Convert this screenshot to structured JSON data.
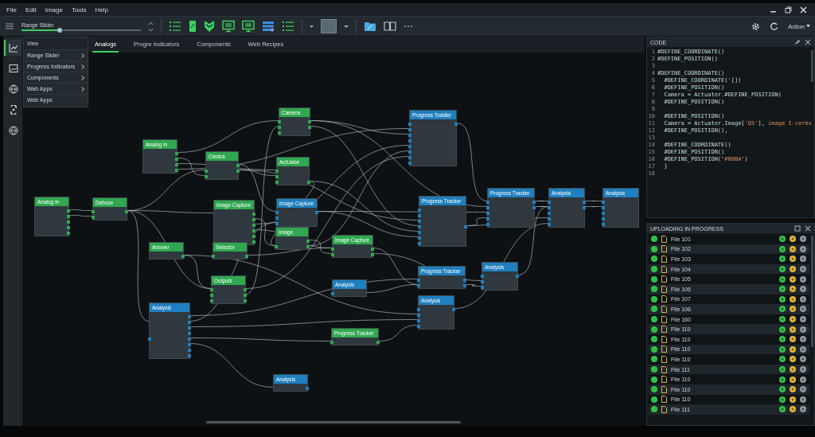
{
  "menu": [
    "File",
    "Edit",
    "Image",
    "Tools",
    "Help"
  ],
  "toolbar": {
    "slider": {
      "label": "Range Slider",
      "level": 0.32
    },
    "account": "Action"
  },
  "sidebar": {
    "items": [
      {
        "selected": true
      },
      {
        "selected": false
      },
      {
        "selected": false
      },
      {
        "selected": false
      },
      {
        "selected": false
      }
    ]
  },
  "dropdown": {
    "header": "View",
    "items": [
      {
        "label": "Range Slider",
        "submenu": true
      },
      {
        "label": "Progress Indicators",
        "submenu": true
      },
      {
        "label": "Components",
        "submenu": true
      },
      {
        "label": "Web Apps",
        "submenu": true
      },
      {
        "label": "Web Apps",
        "submenu": false
      }
    ]
  },
  "tabs": [
    {
      "label": "Analogs",
      "selected": true
    },
    {
      "label": "Progre Indicators",
      "selected": false
    },
    {
      "label": "Components",
      "selected": false
    },
    {
      "label": "Web Recipes",
      "selected": false
    }
  ],
  "nodes": [
    {
      "title": "Analog In",
      "color": "#2fa84f",
      "rows": [
        {
          "in": false,
          "out": true
        },
        {
          "in": false,
          "out": true
        },
        {
          "in": false,
          "out": true
        },
        {
          "in": false,
          "out": true
        },
        {
          "in": false,
          "out": true
        }
      ]
    },
    {
      "title": "Deboce",
      "color": "#2fa84f",
      "rows": [
        {
          "in": true,
          "out": true
        },
        {
          "in": true,
          "out": false
        }
      ]
    },
    {
      "title": "Analog In",
      "color": "#2fa84f",
      "rows": [
        {
          "in": false,
          "out": true
        },
        {
          "in": false,
          "out": true
        },
        {
          "in": false,
          "out": true
        },
        {
          "in": false,
          "out": true
        }
      ]
    },
    {
      "title": "Clestra",
      "color": "#2fa84f",
      "rows": [
        {
          "in": false,
          "out": true
        },
        {
          "in": true,
          "out": true
        },
        {
          "in": true,
          "out": false
        }
      ]
    },
    {
      "title": "Camera",
      "color": "#2fa84f",
      "rows": [
        {
          "in": true,
          "out": true
        },
        {
          "in": true,
          "out": true
        },
        {
          "in": true,
          "out": false
        }
      ]
    },
    {
      "title": "ActUator",
      "color": "#2fa84f",
      "rows": [
        {
          "in": true,
          "out": false
        },
        {
          "in": true,
          "out": false
        },
        {
          "in": true,
          "out": true
        }
      ]
    },
    {
      "title": "Image Capture",
      "color": "#2fa84f",
      "rows": [
        {
          "in": false,
          "out": true
        },
        {
          "in": false,
          "out": true
        },
        {
          "in": false,
          "out": true
        },
        {
          "in": false,
          "out": true
        },
        {
          "in": false,
          "out": true
        },
        {
          "in": false,
          "out": true
        }
      ]
    },
    {
      "title": "Image Capture",
      "color": "#1f7fbf",
      "rows": [
        {
          "in": true,
          "out": true
        },
        {
          "in": true,
          "out": false
        },
        {
          "in": true,
          "out": false
        }
      ]
    },
    {
      "title": "Image",
      "color": "#2fa84f",
      "rows": [
        {
          "in": false,
          "out": true
        },
        {
          "in": true,
          "out": true
        }
      ]
    },
    {
      "title": "Answer",
      "color": "#2fa84f",
      "rows": [
        {
          "in": false,
          "out": true
        }
      ]
    },
    {
      "title": "Selector",
      "color": "#2fa84f",
      "rows": [
        {
          "in": true,
          "out": true
        }
      ]
    },
    {
      "title": "Outputs",
      "color": "#2fa84f",
      "rows": [
        {
          "in": true,
          "out": true
        },
        {
          "in": true,
          "out": true
        },
        {
          "in": true,
          "out": true
        }
      ]
    },
    {
      "title": "Analysis",
      "color": "#1f7fbf",
      "rows": [
        {
          "in": false,
          "out": true
        },
        {
          "in": false,
          "out": true
        },
        {
          "in": false,
          "out": true
        },
        {
          "in": false,
          "out": true
        },
        {
          "in": true,
          "out": true
        },
        {
          "in": false,
          "out": true
        },
        {
          "in": false,
          "out": true
        },
        {
          "in": false,
          "out": true
        }
      ]
    },
    {
      "title": "Progress Toddler",
      "color": "#1f7fbf",
      "rows": [
        {
          "in": true,
          "out": true
        },
        {
          "in": true,
          "out": false
        },
        {
          "in": true,
          "out": false
        },
        {
          "in": true,
          "out": false
        },
        {
          "in": true,
          "out": false
        },
        {
          "in": true,
          "out": false
        },
        {
          "in": true,
          "out": false
        },
        {
          "in": true,
          "out": false
        }
      ]
    },
    {
      "title": "Progress Tracker",
      "color": "#1f7fbf",
      "rows": [
        {
          "in": true,
          "out": false
        },
        {
          "in": true,
          "out": false
        },
        {
          "in": true,
          "out": false
        },
        {
          "in": true,
          "out": true
        },
        {
          "in": true,
          "out": false
        },
        {
          "in": true,
          "out": false
        },
        {
          "in": true,
          "out": false
        }
      ]
    },
    {
      "title": "Image Capture",
      "color": "#2fa84f",
      "rows": [
        {
          "in": true,
          "out": true
        },
        {
          "in": true,
          "out": true
        }
      ]
    },
    {
      "title": "Analysis",
      "color": "#1f7fbf",
      "rows": [
        {
          "in": true,
          "out": false
        }
      ]
    },
    {
      "title": "Progress Tracker",
      "color": "#2fa84f",
      "rows": [
        {
          "in": true,
          "out": true
        }
      ]
    },
    {
      "title": "Progress Tracker",
      "color": "#1f7fbf",
      "rows": [
        {
          "in": true,
          "out": true
        },
        {
          "in": true,
          "out": true
        }
      ]
    },
    {
      "title": "Analysis",
      "color": "#1f7fbf",
      "rows": [
        {
          "in": true,
          "out": true
        },
        {
          "in": true,
          "out": false
        },
        {
          "in": true,
          "out": false
        },
        {
          "in": true,
          "out": false
        }
      ]
    },
    {
      "title": "Analysis",
      "color": "#1f7fbf",
      "rows": [
        {
          "in": true,
          "out": true
        },
        {
          "in": true,
          "out": false
        },
        {
          "in": true,
          "out": false
        }
      ]
    },
    {
      "title": "Progress Tracker",
      "color": "#1f7fbf",
      "rows": [
        {
          "in": true,
          "out": true
        },
        {
          "in": true,
          "out": true
        },
        {
          "in": true,
          "out": false
        },
        {
          "in": true,
          "out": false
        },
        {
          "in": true,
          "out": false
        }
      ]
    },
    {
      "title": "Analysis",
      "color": "#1f7fbf",
      "rows": [
        {
          "in": true,
          "out": true
        },
        {
          "in": true,
          "out": true
        },
        {
          "in": true,
          "out": false
        },
        {
          "in": true,
          "out": false
        },
        {
          "in": true,
          "out": false
        }
      ]
    },
    {
      "title": "Analysis",
      "color": "#1f7fbf",
      "rows": [
        {
          "in": true,
          "out": false
        },
        {
          "in": true,
          "out": false
        },
        {
          "in": true,
          "out": false
        },
        {
          "in": true,
          "out": false
        },
        {
          "in": true,
          "out": false
        }
      ]
    },
    {
      "title": "Analysis",
      "color": "#1f7fbf",
      "rows": [
        {
          "in": false,
          "out": true
        }
      ]
    }
  ],
  "code": {
    "title": "CODE",
    "lines": [
      {
        "n": "1",
        "parts": [
          {
            "kind": "plain",
            "t": "#DEFINE_COORDINATE()"
          }
        ]
      },
      {
        "n": "2",
        "parts": [
          {
            "kind": "plain",
            "t": "#DEFINE_POSITION()"
          }
        ]
      },
      {
        "n": "3"
      },
      {
        "n": "4",
        "parts": [
          {
            "kind": "plain",
            "t": "#DEFINE_COORDINATE()"
          }
        ]
      },
      {
        "n": "5",
        "parts": [
          {
            "kind": "plain",
            "t": "  #DEFINE_COORDINATE('[])"
          }
        ]
      },
      {
        "n": "6",
        "parts": [
          {
            "kind": "plain",
            "t": "  #DEFINE_POSITION()"
          }
        ]
      },
      {
        "n": "7",
        "parts": [
          {
            "kind": "plain",
            "t": "  Camera = Actuator.#DEFINE_POSITION)"
          }
        ]
      },
      {
        "n": "8",
        "parts": [
          {
            "kind": "plain",
            "t": "  #DEFINE_POSITION()"
          }
        ]
      },
      {
        "n": "9"
      },
      {
        "n": "10",
        "parts": [
          {
            "kind": "plain",
            "t": "  #DEFINE_POSITION()"
          }
        ]
      },
      {
        "n": "11",
        "parts": [
          {
            "kind": "plain",
            "t": "  Camera = Actuator.Image["
          },
          {
            "kind": "string",
            "t": "'OS'"
          },
          {
            "kind": "plain",
            "t": "], "
          },
          {
            "kind": "string",
            "t": "image I-ceres"
          }
        ]
      },
      {
        "n": "12",
        "parts": [
          {
            "kind": "plain",
            "t": "  #DEFINE_POSITION(),"
          }
        ]
      },
      {
        "n": "13"
      },
      {
        "n": "14",
        "parts": [
          {
            "kind": "plain",
            "t": "  #DEFINE_COORDINATE()"
          }
        ]
      },
      {
        "n": "15",
        "parts": [
          {
            "kind": "plain",
            "t": "  #DEFINE_POSITION()"
          }
        ]
      },
      {
        "n": "16",
        "parts": [
          {
            "kind": "plain",
            "t": "  #DEFINE_POSITION("
          },
          {
            "kind": "string",
            "t": "\"#000A\""
          },
          {
            "kind": "plain",
            "t": ")"
          }
        ]
      },
      {
        "n": "17",
        "parts": [
          {
            "kind": "plain",
            "t": "  }"
          }
        ]
      },
      {
        "n": "18"
      }
    ]
  },
  "uploads": {
    "title": "UPLOADING IN PROGRESS",
    "files": [
      "File 101",
      "File 102",
      "File 103",
      "File 104",
      "File 105",
      "File 106",
      "File 107",
      "File 106",
      "File 160",
      "File 110",
      "File 110",
      "File 110",
      "File 110",
      "File 111",
      "File 110",
      "File 110",
      "File 110",
      "File 111"
    ]
  }
}
